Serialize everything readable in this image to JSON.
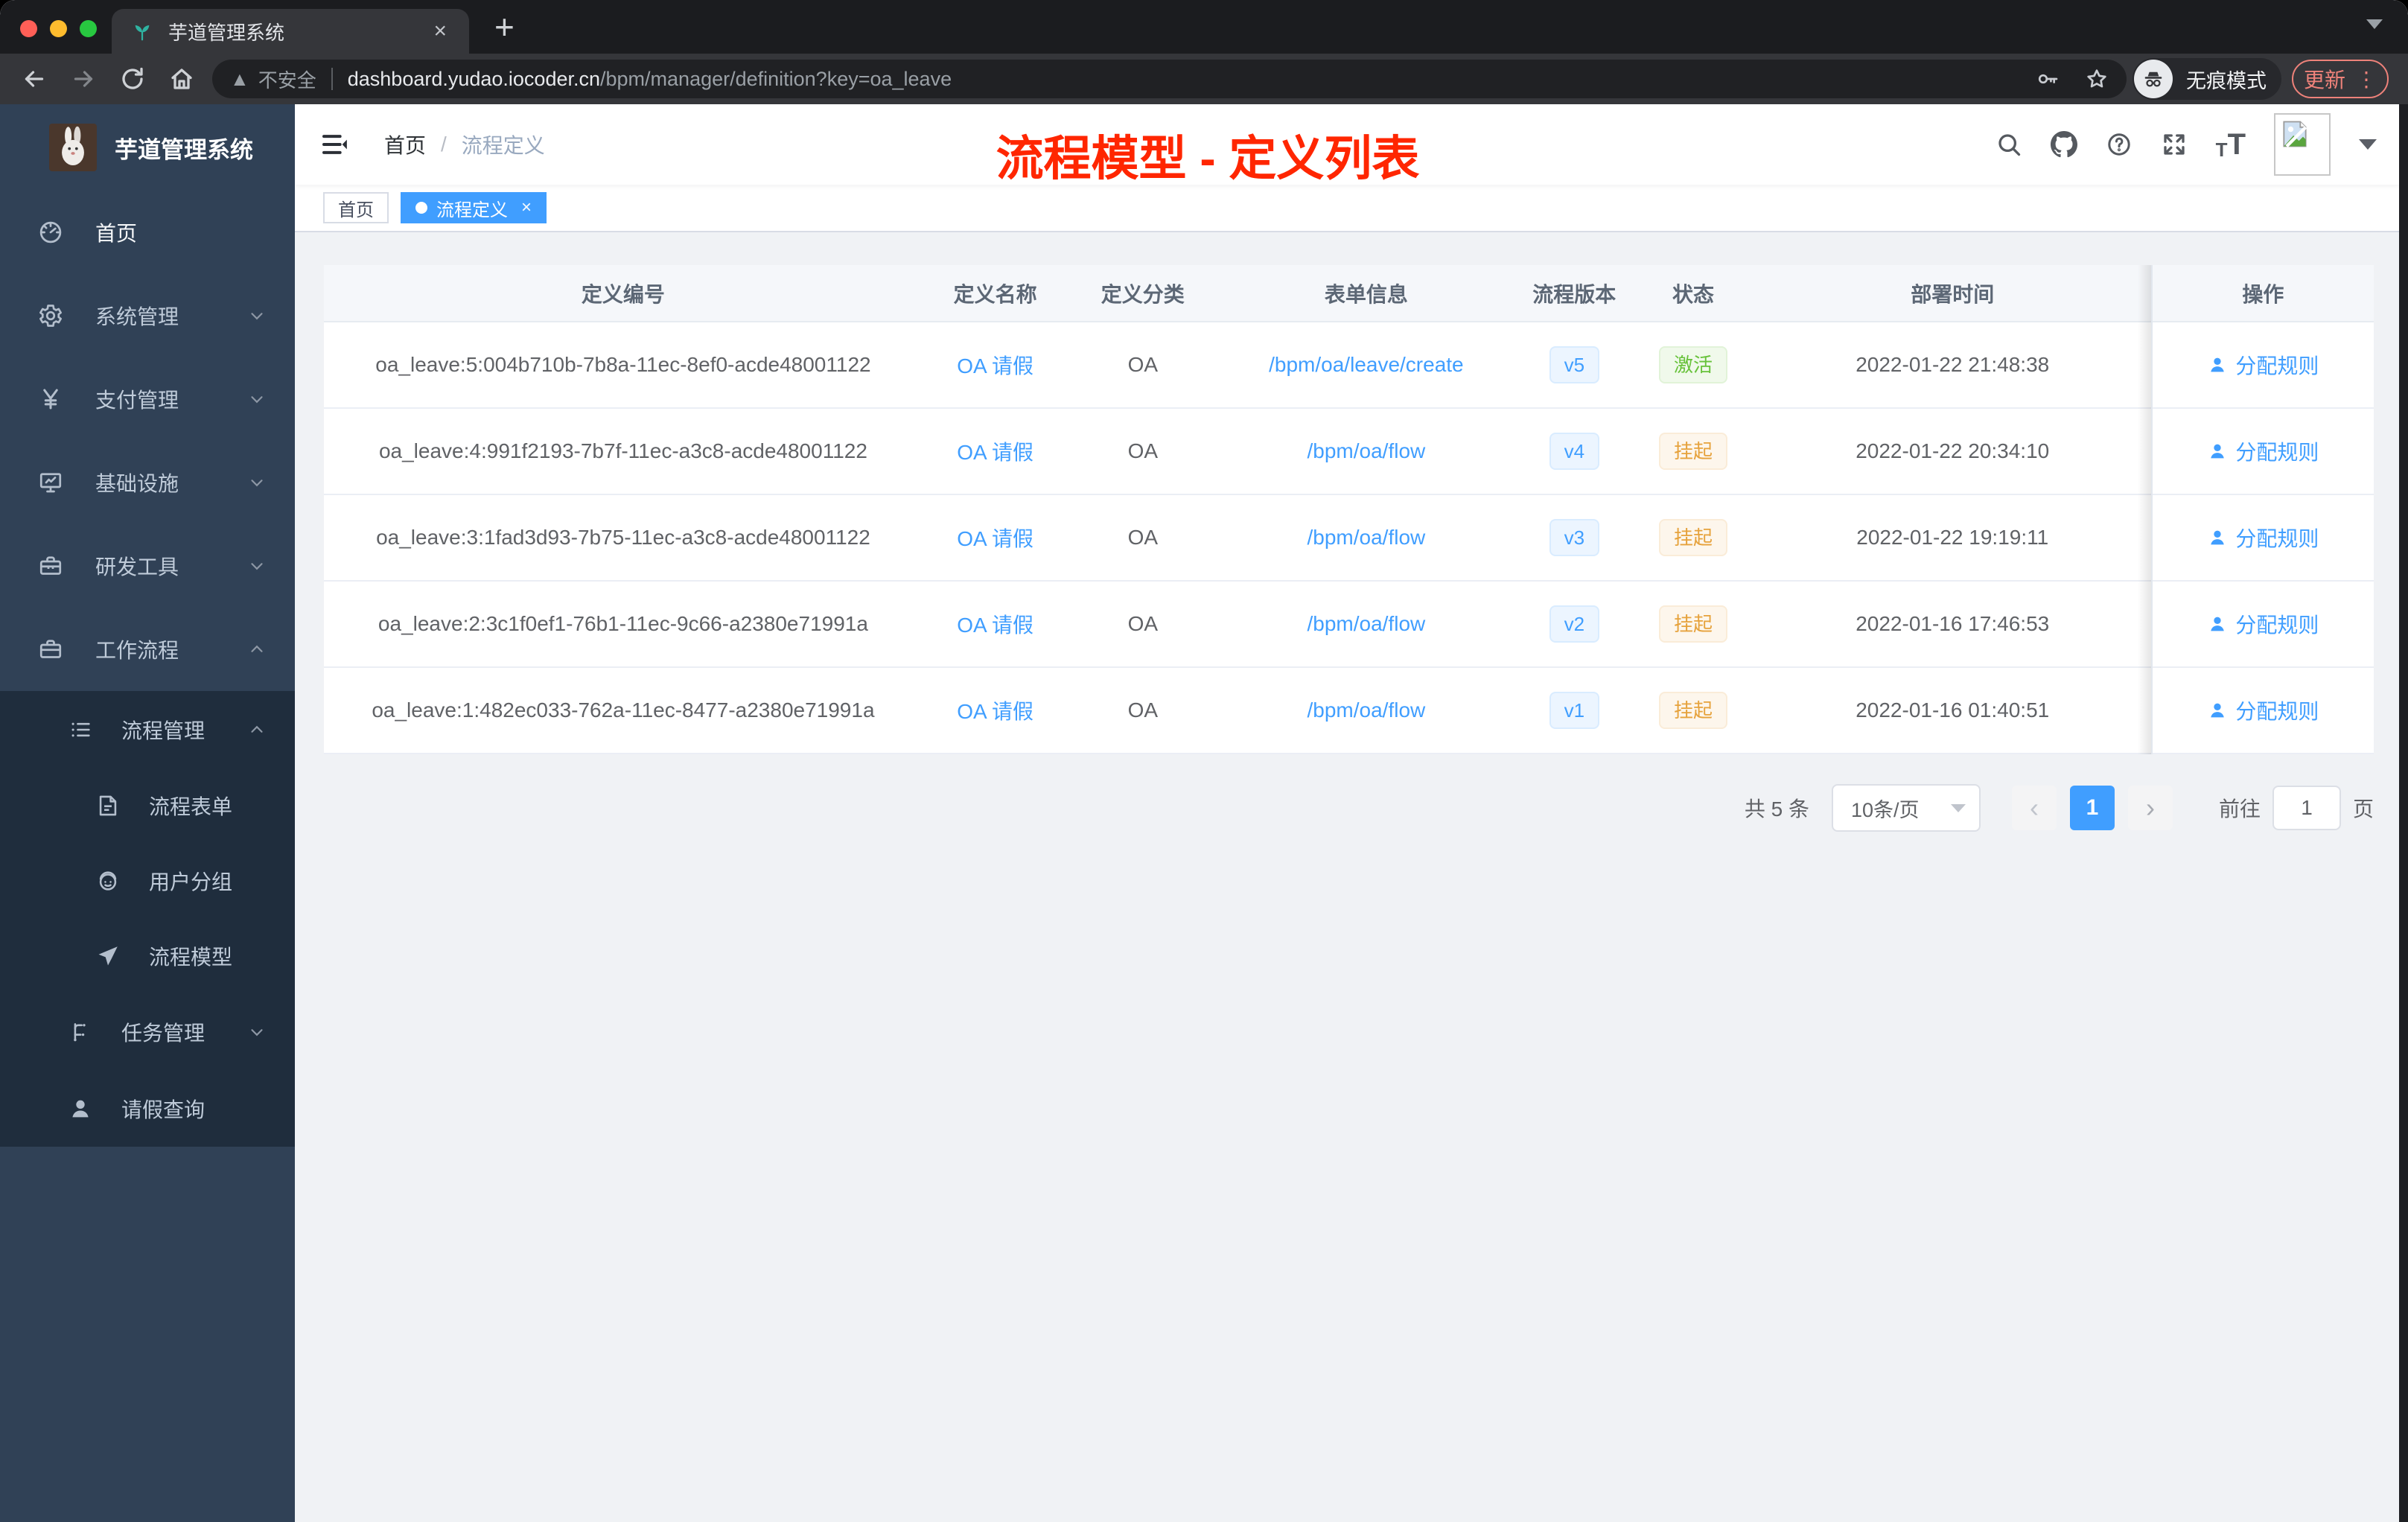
{
  "browser": {
    "tab_title": "芋道管理系统",
    "new_tab_glyph": "+",
    "tab_close_glyph": "×",
    "security_label": "不安全",
    "url_host": "dashboard.yudao.iocoder.cn",
    "url_path": "/bpm/manager/definition?key=oa_leave",
    "incognito_label": "无痕模式",
    "update_label": "更新",
    "menu_dots_glyph": "⋮"
  },
  "sidebar": {
    "app_title": "芋道管理系统",
    "items": [
      {
        "label": "首页",
        "icon": "gauge-icon"
      },
      {
        "label": "系统管理",
        "icon": "gear-icon"
      },
      {
        "label": "支付管理",
        "icon": "yen-icon"
      },
      {
        "label": "基础设施",
        "icon": "monitor-icon"
      },
      {
        "label": "研发工具",
        "icon": "toolbox-icon"
      },
      {
        "label": "工作流程",
        "icon": "briefcase-icon"
      },
      {
        "label": "流程管理",
        "icon": "list-icon"
      },
      {
        "label": "流程表单",
        "icon": "form-icon"
      },
      {
        "label": "用户分组",
        "icon": "robot-icon"
      },
      {
        "label": "流程模型",
        "icon": "send-icon"
      },
      {
        "label": "任务管理",
        "icon": "tree-icon"
      },
      {
        "label": "请假查询",
        "icon": "user-icon"
      }
    ]
  },
  "header": {
    "breadcrumb_root": "首页",
    "breadcrumb_sep": "/",
    "breadcrumb_current": "流程定义",
    "overlay_title": "流程模型 - 定义列表"
  },
  "tags": {
    "home": "首页",
    "active": "流程定义",
    "close_glyph": "×"
  },
  "table": {
    "columns": [
      "定义编号",
      "定义名称",
      "定义分类",
      "表单信息",
      "流程版本",
      "状态",
      "部署时间",
      "操作"
    ],
    "action_label": "分配规则",
    "rows": [
      {
        "id": "oa_leave:5:004b710b-7b8a-11ec-8ef0-acde48001122",
        "name": "OA 请假",
        "category": "OA",
        "form": "/bpm/oa/leave/create",
        "version": "v5",
        "status": "激活",
        "status_type": "success",
        "time": "2022-01-22 21:48:38"
      },
      {
        "id": "oa_leave:4:991f2193-7b7f-11ec-a3c8-acde48001122",
        "name": "OA 请假",
        "category": "OA",
        "form": "/bpm/oa/flow",
        "version": "v4",
        "status": "挂起",
        "status_type": "warning",
        "time": "2022-01-22 20:34:10"
      },
      {
        "id": "oa_leave:3:1fad3d93-7b75-11ec-a3c8-acde48001122",
        "name": "OA 请假",
        "category": "OA",
        "form": "/bpm/oa/flow",
        "version": "v3",
        "status": "挂起",
        "status_type": "warning",
        "time": "2022-01-22 19:19:11"
      },
      {
        "id": "oa_leave:2:3c1f0ef1-76b1-11ec-9c66-a2380e71991a",
        "name": "OA 请假",
        "category": "OA",
        "form": "/bpm/oa/flow",
        "version": "v2",
        "status": "挂起",
        "status_type": "warning",
        "time": "2022-01-16 17:46:53"
      },
      {
        "id": "oa_leave:1:482ec033-762a-11ec-8477-a2380e71991a",
        "name": "OA 请假",
        "category": "OA",
        "form": "/bpm/oa/flow",
        "version": "v1",
        "status": "挂起",
        "status_type": "warning",
        "time": "2022-01-16 01:40:51"
      }
    ]
  },
  "pagination": {
    "total": "共 5 条",
    "page_size": "10条/页",
    "prev_glyph": "‹",
    "current": "1",
    "next_glyph": "›",
    "goto_label": "前往",
    "goto_value": "1",
    "unit_label": "页"
  },
  "colors": {
    "accent": "#409eff",
    "success": "#67c23a",
    "warning": "#e6a23c",
    "sidebar_bg": "#304156",
    "sidebar_sub_bg": "#1f2d3d",
    "overlay_title": "#ff2600",
    "update_button": "#ee827a"
  }
}
